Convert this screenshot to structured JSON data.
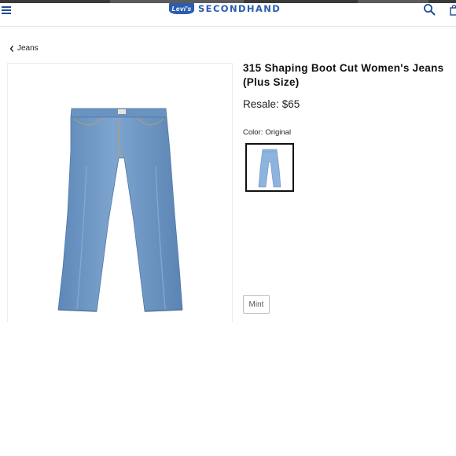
{
  "header": {
    "logo_mark": "Levi's",
    "logo_text": "SECONDHAND",
    "menu_icon": "hamburger-menu-icon",
    "search_icon": "search-icon",
    "bag_icon": "shopping-bag-icon",
    "brand_color": "#2a5db0"
  },
  "breadcrumb": {
    "label": "Jeans",
    "icon": "chevron-left-icon"
  },
  "product": {
    "title": "315 Shaping Boot Cut Women's Jeans (Plus Size)",
    "price_label": "Resale:",
    "price": "$65",
    "color_label": "Color:",
    "color_value": "Original",
    "condition": "Mint",
    "denim_color": "#6f98c4"
  }
}
